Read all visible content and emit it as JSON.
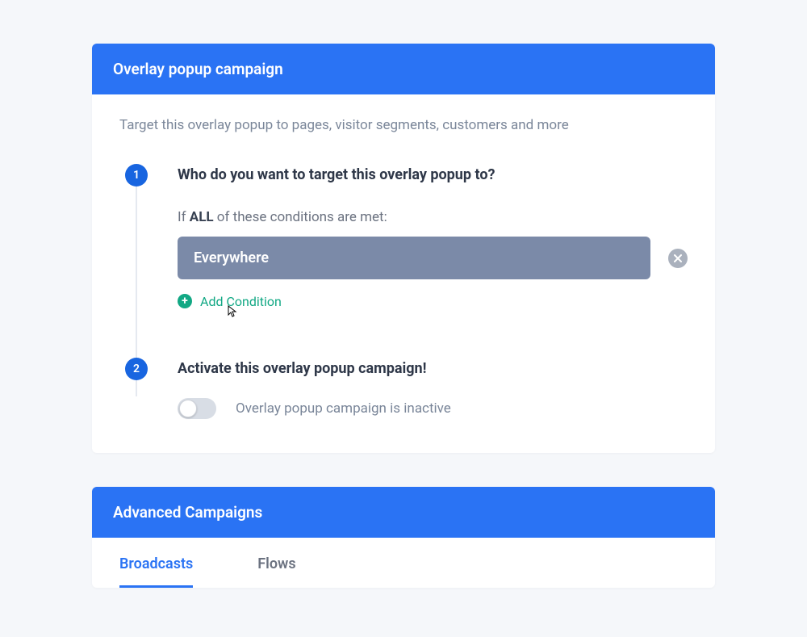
{
  "overlay_card": {
    "header": "Overlay popup campaign",
    "subtitle": "Target this overlay popup to pages, visitor segments, customers and more",
    "steps": [
      {
        "number": "1",
        "title": "Who do you want to target this overlay popup to?",
        "conditions_intro_prefix": "If ",
        "conditions_intro_bold": "ALL",
        "conditions_intro_suffix": " of these conditions are met:",
        "condition_value": "Everywhere",
        "add_condition_label": "Add Condition"
      },
      {
        "number": "2",
        "title": "Activate this overlay popup campaign!",
        "toggle_active": false,
        "toggle_label": "Overlay popup campaign is inactive"
      }
    ]
  },
  "advanced_card": {
    "header": "Advanced Campaigns",
    "tabs": [
      {
        "label": "Broadcasts",
        "active": true
      },
      {
        "label": "Flows",
        "active": false
      }
    ]
  }
}
